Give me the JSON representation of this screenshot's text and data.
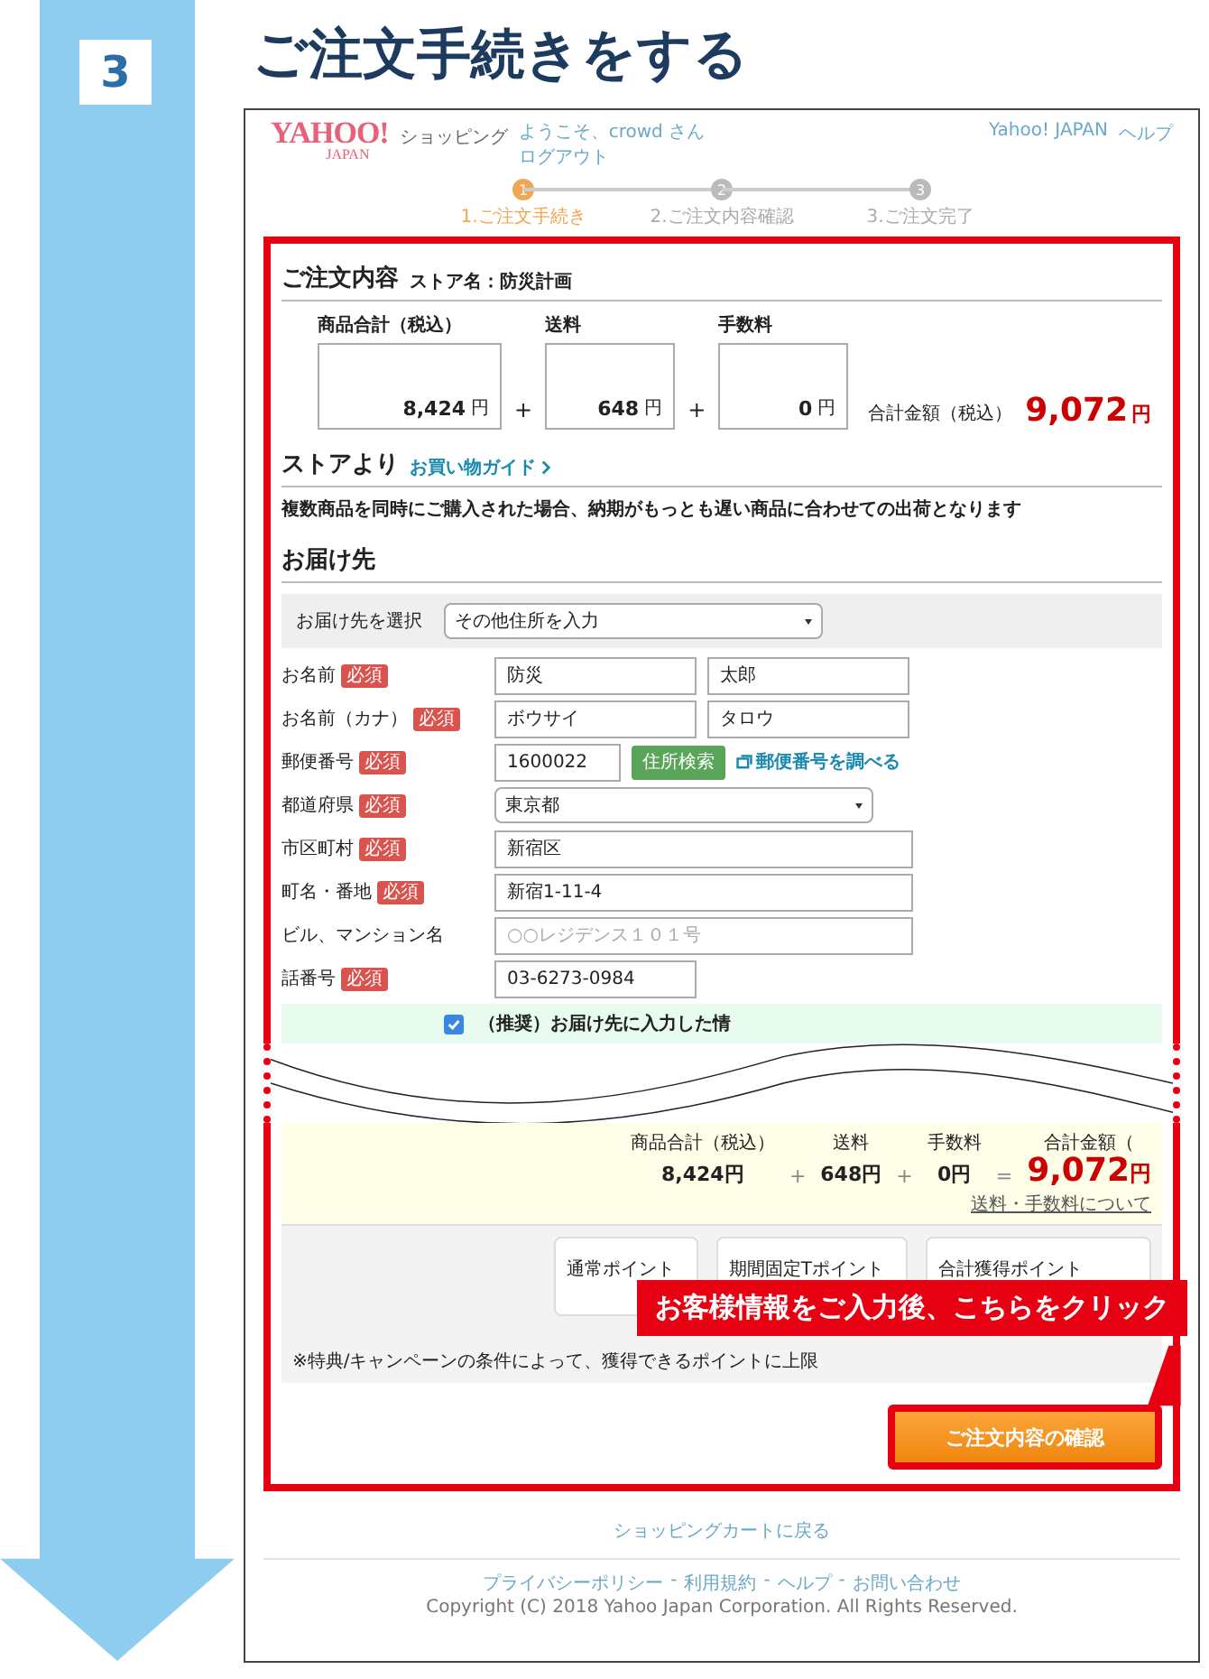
{
  "guide": {
    "step_number": "3",
    "title": "ご注文手続きをする",
    "callout": "お客様情報をご入力後、こちらをクリック"
  },
  "header": {
    "logo": "YAHOO!",
    "logo_sub": "JAPAN",
    "service": "ショッピング",
    "greeting": "ようこそ、crowd さん",
    "logout": "ログアウト",
    "links": [
      "Yahoo! JAPAN",
      "ヘルプ"
    ]
  },
  "steps": [
    {
      "number": "1",
      "label": "1.ご注文手続き",
      "selected": true
    },
    {
      "number": "2",
      "label": "2.ご注文内容確認",
      "selected": false
    },
    {
      "number": "3",
      "label": "3.ご注文完了",
      "selected": false
    }
  ],
  "order": {
    "heading": "ご注文内容",
    "store": "ストア名：防災計画",
    "amounts": [
      {
        "label": "商品合計（税込）",
        "value": "8,424",
        "unit": "円"
      },
      {
        "label": "送料",
        "value": "648",
        "unit": "円"
      },
      {
        "label": "手数料",
        "value": "0",
        "unit": "円"
      }
    ],
    "operator": "+",
    "total_label": "合計金額（税込）",
    "total": "9,072",
    "total_unit": "円"
  },
  "store_note": {
    "heading": "ストアより",
    "guide_link": "お買い物ガイド",
    "text": "複数商品を同時にご購入された場合、納期がもっとも遅い商品に合わせての出荷となります"
  },
  "delivery": {
    "heading": "お届け先",
    "select_label": "お届け先を選択",
    "select_value": "その他住所を入力",
    "rows": [
      {
        "kind": "pair",
        "label": "お名前",
        "badge": "必須",
        "values": [
          "防災",
          "太郎"
        ]
      },
      {
        "kind": "pair",
        "label": "お名前（カナ）",
        "badge": "必須",
        "values": [
          "ボウサイ",
          "タロウ"
        ]
      },
      {
        "kind": "postal",
        "label": "郵便番号",
        "badge": "必須",
        "value": "1600022",
        "button": "住所検索",
        "link": "郵便番号を調べる"
      },
      {
        "kind": "select",
        "label": "都道府県",
        "badge": "必須",
        "value": "東京都"
      },
      {
        "kind": "text",
        "label": "市区町村",
        "badge": "必須",
        "value": "新宿区"
      },
      {
        "kind": "text",
        "label": "町名・番地",
        "badge": "必須",
        "value": "新宿1-11-4"
      },
      {
        "kind": "text",
        "label": "ビル、マンション名",
        "placeholder": "○○レジデンス１０１号"
      },
      {
        "kind": "short",
        "label": "話番号",
        "badge": "必須",
        "value": "03-6273-0984"
      }
    ],
    "consent": {
      "checked": true,
      "text": "（推奨）お届け先に入力した情"
    }
  },
  "summary": {
    "labels": [
      "商品合計（税込）",
      "送料",
      "手数料",
      "合計金額（"
    ],
    "values": [
      "8,424円",
      "648円",
      "0円"
    ],
    "operators": [
      "+",
      "+",
      "="
    ],
    "total": "9,072",
    "total_unit": "円",
    "link": "送料・手数料について"
  },
  "points": {
    "boxes": [
      "通常ポイント",
      "期間固定Tポイント",
      "合計獲得ポイント"
    ],
    "note": "※特典/キャンペーンの条件によって、獲得できるポイントに上限"
  },
  "confirm_button": "ご注文内容の確認",
  "back_link": "ショッピングカートに戻る",
  "footer": {
    "links": [
      "プライバシーポリシー",
      "利用規約",
      "ヘルプ",
      "お問い合わせ"
    ],
    "separator": "-",
    "copyright": "Copyright (C) 2018 Yahoo Japan Corporation. All Rights Reserved."
  }
}
